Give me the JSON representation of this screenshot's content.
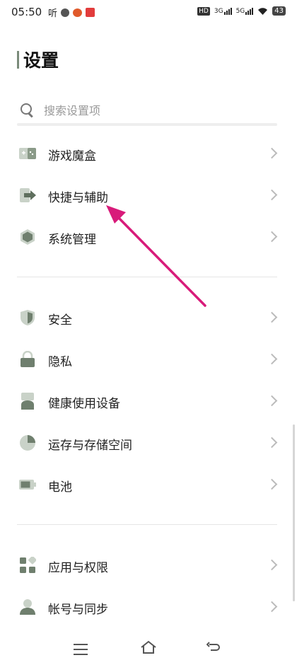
{
  "status_bar": {
    "time": "05:50",
    "app_text": "听",
    "hd": "HD",
    "net1": "3G",
    "net2": "5G",
    "battery": "43"
  },
  "page_title": "设置",
  "search": {
    "placeholder": "搜索设置项"
  },
  "groups": [
    {
      "items": [
        {
          "label": "游戏魔盒",
          "icon": "gamepad-icon"
        },
        {
          "label": "快捷与辅助",
          "icon": "shortcut-icon"
        },
        {
          "label": "系统管理",
          "icon": "hexagon-icon"
        }
      ]
    },
    {
      "items": [
        {
          "label": "安全",
          "icon": "shield-icon"
        },
        {
          "label": "隐私",
          "icon": "lock-icon"
        },
        {
          "label": "健康使用设备",
          "icon": "hourglass-icon"
        },
        {
          "label": "运存与存储空间",
          "icon": "pie-chart-icon"
        },
        {
          "label": "电池",
          "icon": "battery-icon"
        }
      ]
    },
    {
      "items": [
        {
          "label": "应用与权限",
          "icon": "apps-grid-icon"
        },
        {
          "label": "帐号与同步",
          "icon": "person-icon"
        }
      ]
    }
  ],
  "colors": {
    "icon": "#8a9a88",
    "annotation": "#d81b7a"
  }
}
